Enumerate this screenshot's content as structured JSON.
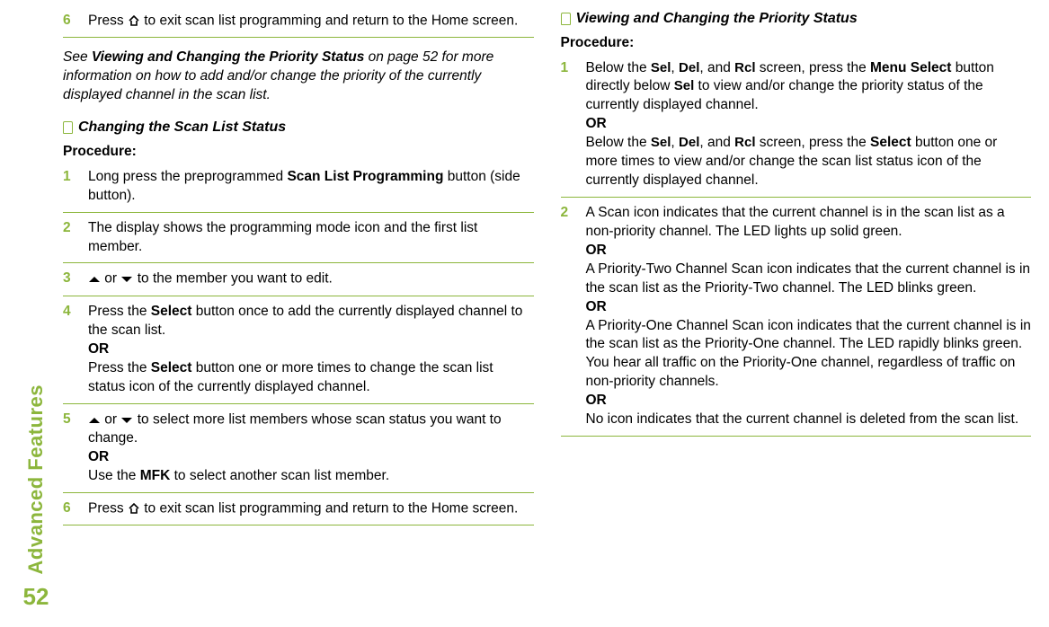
{
  "sidebar": {
    "label": "Advanced Features",
    "page_number": "52"
  },
  "left": {
    "step6": {
      "n": "6",
      "t1": "Press ",
      "t2": " to exit scan list programming and return to the Home screen."
    },
    "note": {
      "pre": "See ",
      "bold": "Viewing and Changing the Priority Status",
      "post": " on page 52 for more information on how to add and/or change the priority of the currently displayed channel in the scan list."
    },
    "h1": "Changing the Scan List Status",
    "proc": "Procedure:",
    "s1": {
      "n": "1",
      "t1": "Long press the preprogrammed ",
      "b": "Scan List Programming",
      "t2": " button (side button)."
    },
    "s2": {
      "n": "2",
      "t": "The display shows the programming mode icon and the first list member."
    },
    "s3": {
      "n": "3",
      "t1": " or ",
      "t2": " to the member you want to edit."
    },
    "s4": {
      "n": "4",
      "t1": "Press the ",
      "b1": "Select",
      "t2": " button once to add the currently displayed channel to the scan list.",
      "or": "OR",
      "t3": "Press the ",
      "b2": "Select",
      "t4": " button one or more times to change the scan list status icon of the currently displayed channel."
    },
    "s5": {
      "n": "5",
      "t1": " or ",
      "t2": " to select more list members whose scan status you want to change.",
      "or": "OR",
      "t3": "Use the ",
      "b": "MFK",
      "t4": " to select another scan list member."
    },
    "s6": {
      "n": "6",
      "t1": "Press ",
      "t2": " to exit scan list programming and return to the Home screen."
    }
  },
  "right": {
    "h1": "Viewing and Changing the Priority Status",
    "proc": "Procedure:",
    "s1": {
      "n": "1",
      "t1": "Below the ",
      "k1": "Sel",
      "c1": ", ",
      "k2": "Del",
      "c2": ", and ",
      "k3": "Rcl",
      "t2": " screen, press the ",
      "b1": "Menu Select",
      "t3": " button directly below ",
      "k4": "Sel",
      "t4": " to view and/or change the priority status of the currently displayed channel.",
      "or": "OR",
      "t5": "Below the ",
      "k5": "Sel",
      "c3": ", ",
      "k6": "Del",
      "c4": ", and ",
      "k7": "Rcl",
      "t6": " screen, press the ",
      "b2": "Select",
      "t7": " button one or more times to view and/or change the scan list status icon of the currently displayed channel."
    },
    "s2": {
      "n": "2",
      "t1": "A Scan icon indicates that the current channel is in the scan list as a non-priority channel. The LED lights up solid green.",
      "or1": "OR",
      "t2": "A Priority-Two Channel Scan icon indicates that the current channel is in the scan list as the Priority-Two channel. The LED blinks green.",
      "or2": "OR",
      "t3": "A Priority-One Channel Scan icon indicates that the current channel is in the scan list as the Priority-One channel. The LED rapidly blinks green. You hear all traffic on the Priority-One channel, regardless of traffic on non-priority channels.",
      "or3": "OR",
      "t4": "No icon indicates that the current channel is deleted from the scan list."
    }
  }
}
